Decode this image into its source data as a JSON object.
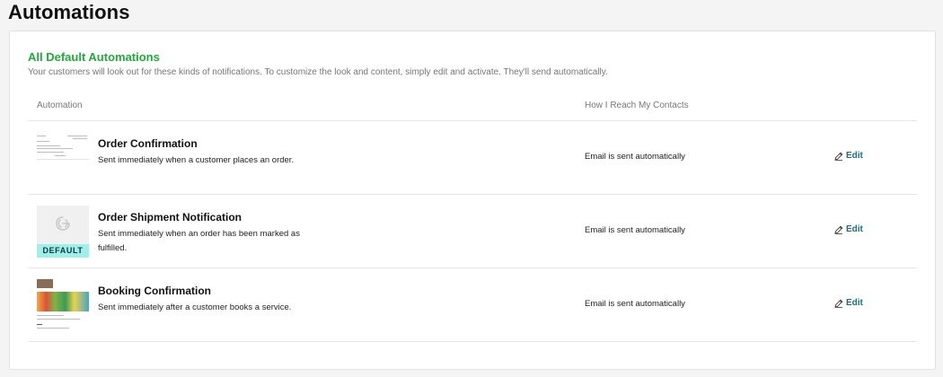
{
  "page": {
    "title": "Automations"
  },
  "section": {
    "title": "All Default Automations",
    "description": "Your customers will look out for these kinds of notifications. To customize the look and content, simply edit and activate. They'll send automatically."
  },
  "table": {
    "headers": {
      "automation": "Automation",
      "reach": "How I Reach My Contacts"
    },
    "rows": [
      {
        "name": "Order Confirmation",
        "description": "Sent immediately when a customer places an order.",
        "reach": "Email is sent automatically",
        "action_label": "Edit",
        "thumbnail": "email-preview"
      },
      {
        "name": "Order Shipment Notification",
        "description": "Sent immediately when an order has been marked as fulfilled.",
        "reach": "Email is sent automatically",
        "action_label": "Edit",
        "thumbnail": "default-placeholder",
        "badge": "DEFAULT"
      },
      {
        "name": "Booking Confirmation",
        "description": "Sent immediately after a customer books a service.",
        "reach": "Email is sent automatically",
        "action_label": "Edit",
        "thumbnail": "booking-preview"
      }
    ]
  },
  "colors": {
    "section_title": "#1faa3a",
    "edit_link": "#1b6e80",
    "default_badge_bg": "#9ff0ea"
  },
  "icons": {
    "edit": "pencil-icon",
    "placeholder": "brand-logo-icon"
  }
}
